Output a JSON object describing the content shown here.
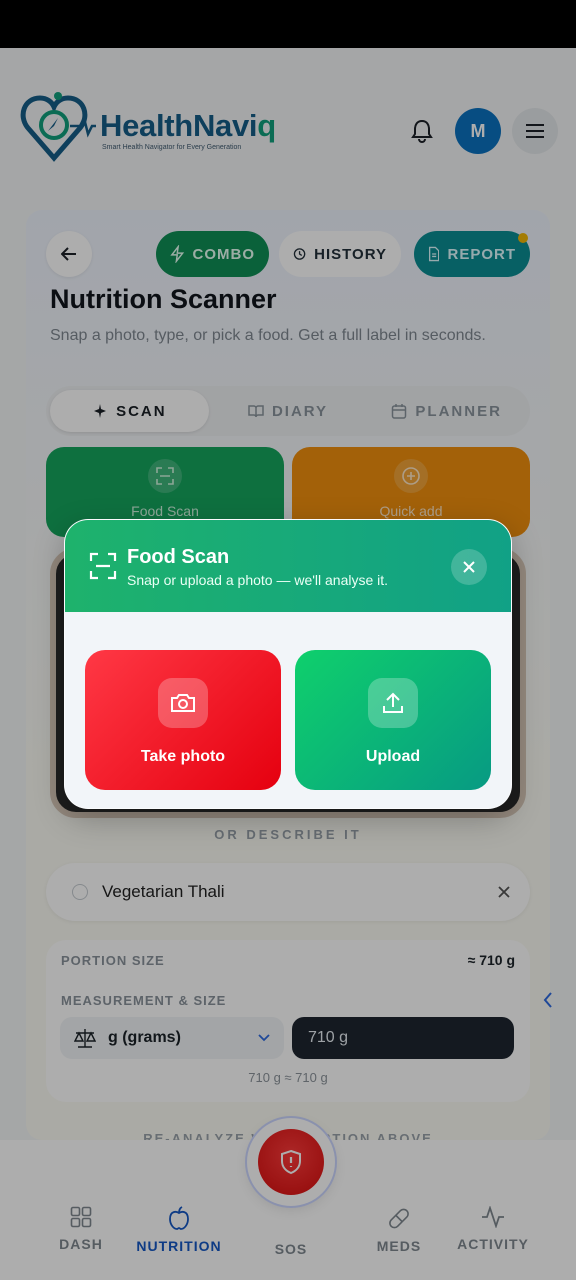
{
  "header": {
    "brand_main": "HealthNavi",
    "brand_accent": "q",
    "tagline": "Smart Health Navigator for Every Generation",
    "avatar_initial": "M"
  },
  "toolbar": {
    "combo_label": "COMBO",
    "history_label": "HISTORY",
    "report_label": "REPORT"
  },
  "page": {
    "title": "Nutrition Scanner",
    "subtitle": "Snap a photo, type, or pick a food. Get a full label in seconds."
  },
  "tabs": [
    {
      "label": "SCAN",
      "active": true
    },
    {
      "label": "DIARY",
      "active": false
    },
    {
      "label": "PLANNER",
      "active": false
    }
  ],
  "tiles": {
    "food_scan": "Food Scan",
    "quick_add": "Quick add"
  },
  "describe": {
    "or_label": "OR DESCRIBE IT",
    "value": "Vegetarian Thali"
  },
  "portion": {
    "label": "PORTION SIZE",
    "value": "≈ 710 g",
    "measure_label": "MEASUREMENT & SIZE",
    "unit": "g (grams)",
    "quantity": "710 g",
    "conversion": "710 g ≈ 710 g",
    "reanalyze": "RE-ANALYZE WITH PORTION ABOVE"
  },
  "nav": {
    "dash": "DASH",
    "nutrition": "NUTRITION",
    "sos": "SOS",
    "meds": "MEDS",
    "activity": "ACTIVITY"
  },
  "modal": {
    "title": "Food Scan",
    "subtitle": "Snap or upload a photo — we'll analyse it.",
    "take_photo": "Take photo",
    "upload": "Upload"
  },
  "colors": {
    "brand_blue": "#165e88",
    "brand_green": "#11a07d",
    "modal_header": "#1eb26c",
    "take_photo": "#ef1622",
    "upload": "#0bb57a",
    "nav_active": "#1557c4"
  }
}
